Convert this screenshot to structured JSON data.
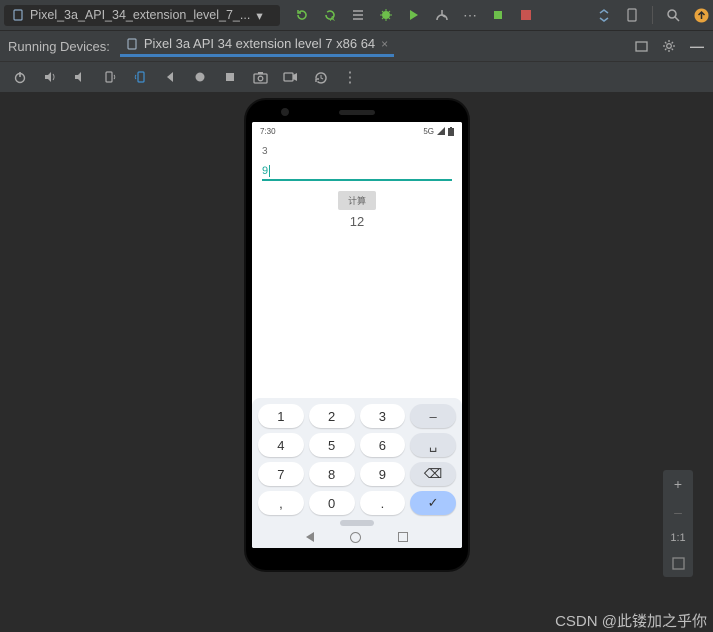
{
  "toolbar": {
    "config_name": "Pixel_3a_API_34_extension_level_7_..."
  },
  "run": {
    "label": "Running Devices:",
    "active_tab": "Pixel 3a API 34 extension level 7 x86 64"
  },
  "phone": {
    "status": {
      "time": "7:30",
      "right": "5G"
    },
    "input1": "3",
    "input2": "9",
    "btn": "计算",
    "result": "12",
    "keys": {
      "r1": [
        "1",
        "2",
        "3",
        "–"
      ],
      "r2": [
        "4",
        "5",
        "6",
        "␣"
      ],
      "r3": [
        "7",
        "8",
        "9",
        "⌫"
      ],
      "r4": [
        ",",
        "0",
        ".",
        "✓"
      ]
    }
  },
  "zoom": {
    "in": "+",
    "out": "–",
    "one": "1:1"
  },
  "watermark": "CSDN @此镂加之乎你"
}
